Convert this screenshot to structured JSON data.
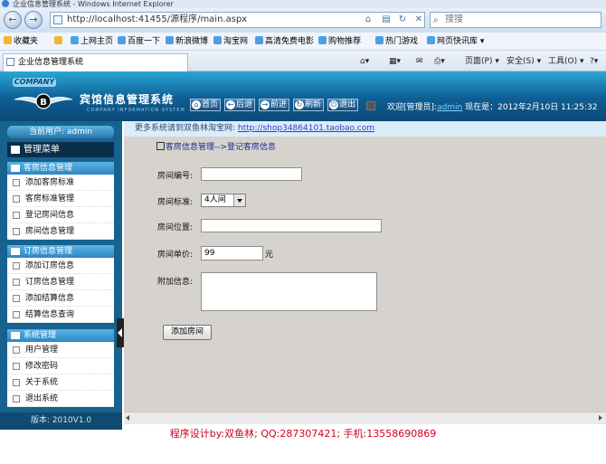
{
  "browser": {
    "window_title": "企业信息管理系统 - Windows Internet Explorer",
    "address": "http://localhost:41455/源程序/main.aspx",
    "search_placeholder": "搜搜",
    "tab_title": "企业信息管理系统",
    "favorites_label": "收藏夹",
    "favorites": [
      "上网主页",
      "百度一下",
      "新浪微博",
      "淘宝网",
      "高清免费电影",
      "购物推荐",
      "热门游戏",
      "网页快讯库"
    ],
    "commands": [
      "页面(P)",
      "安全(S)",
      "工具(O)"
    ]
  },
  "header": {
    "badge": "COMPANY",
    "title": "宾馆信息管理系统",
    "subtitle": "COMPANY INFORMATION SYSTEM",
    "buttons": [
      "首页",
      "后退",
      "前进",
      "刷新",
      "退出"
    ],
    "welcome_prefix": "欢迎[管理员]:",
    "user": "admin",
    "date_text": " 现在是：2012年2月10日 11:25:32"
  },
  "sidebar": {
    "current_user": "当前用户: admin",
    "menu_title": "管理菜单",
    "sections": [
      {
        "title": "客房信息管理",
        "items": [
          "添加客房标准",
          "客房标准管理",
          "登记房间信息",
          "房间信息管理"
        ]
      },
      {
        "title": "订房信息管理",
        "items": [
          "添加订房信息",
          "订房信息管理",
          "添加结算信息",
          "结算信息查询"
        ]
      },
      {
        "title": "系统管理",
        "items": [
          "用户管理",
          "修改密码",
          "关于系统",
          "退出系统"
        ]
      }
    ],
    "version": "版本: 2010V1.0"
  },
  "info": {
    "text": "更多系统请到双鱼林淘宝网:",
    "link": "http://shop34864101.taobao.com"
  },
  "form": {
    "breadcrumb": "客房信息管理-->登记客房信息",
    "room_no_label": "房间编号:",
    "room_no_value": "",
    "standard_label": "房间标准:",
    "standard_value": "4人间",
    "position_label": "房间位置:",
    "position_value": "",
    "price_label": "房间单价:",
    "price_value": "99",
    "price_unit": "元",
    "extra_label": "附加信息:",
    "extra_value": "",
    "submit_label": "添加房间"
  },
  "footer": "程序设计by:双鱼林;   QQ:287307421;    手机:13558690869"
}
